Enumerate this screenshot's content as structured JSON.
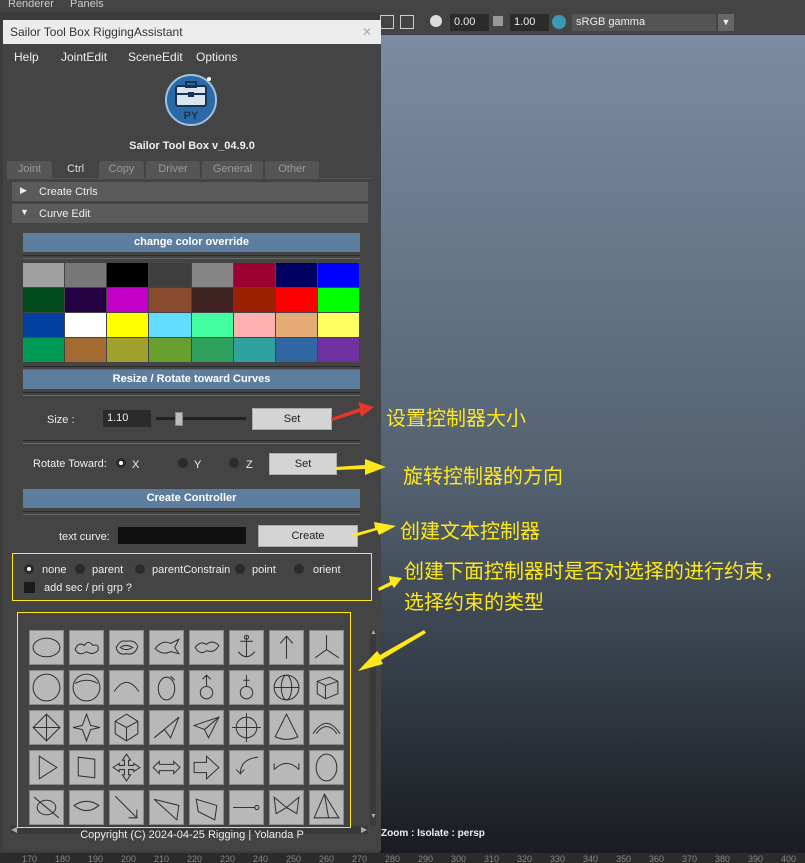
{
  "maya": {
    "menus": [
      "Renderer",
      "Panels"
    ],
    "toolbar": {
      "value1": "0.00",
      "value2": "1.00",
      "color_space": "sRGB gamma"
    },
    "viewport_status": "Zoom : Isolate : persp",
    "timeline_ticks": [
      "170",
      "180",
      "190",
      "200",
      "210",
      "220",
      "230",
      "240",
      "250",
      "260",
      "270",
      "280",
      "290",
      "300",
      "310",
      "320",
      "330",
      "340",
      "350",
      "360",
      "370",
      "380",
      "390",
      "400"
    ]
  },
  "window": {
    "title": "Sailor Tool Box RiggingAssistant",
    "menus": [
      "Help",
      "JointEdit",
      "SceneEdit",
      "Options"
    ],
    "logo_text": "PY",
    "version": "Sailor Tool Box v_04.9.0",
    "tabs": [
      "Joint",
      "Ctrl",
      "Copy",
      "Driver",
      "General",
      "Other"
    ],
    "active_tab": "Ctrl",
    "frames": {
      "create_ctrls": "Create Ctrls",
      "curve_edit": "Curve Edit"
    },
    "sections": {
      "color_override": "change color override",
      "resize_rotate": "Resize / Rotate toward Curves",
      "create_controller": "Create Controller"
    },
    "palette": [
      "#a0a0a0",
      "#787878",
      "#000000",
      "#3f3f3f",
      "#868686",
      "#9a0030",
      "#000060",
      "#0000ff",
      "#004a1c",
      "#250043",
      "#c400c8",
      "#894c30",
      "#3f2322",
      "#9a2100",
      "#ff0000",
      "#00ff00",
      "#0041a0",
      "#ffffff",
      "#ffff00",
      "#64dcff",
      "#43ffa2",
      "#ffb0b0",
      "#e4ab78",
      "#ffff63",
      "#009a54",
      "#a36a31",
      "#9fa030",
      "#68a030",
      "#30a15c",
      "#30a19c",
      "#3066a1",
      "#6f30a1"
    ],
    "size_label": "Size :",
    "size_value": "1.10",
    "set_label": "Set",
    "rotate_label": "Rotate Toward:",
    "axes": [
      "X",
      "Y",
      "Z"
    ],
    "text_curve_label": "text curve:",
    "text_curve_value": "",
    "create_label": "Create",
    "constraints": [
      "none",
      "parent",
      "parentConstrain",
      "point",
      "orient"
    ],
    "add_grp_label": "add sec / pri grp ?",
    "copyright": "Copyright (C)  2024-04-25 Rigging  | Yolanda P"
  },
  "annotations": {
    "size": "设置控制器大小",
    "rotate": "旋转控制器的方向",
    "text": "创建文本控制器",
    "constraint": "创建下面控制器时是否对选择的进行约束，选择约束的类型"
  },
  "colors": {
    "annotation": "#ffe81a",
    "arrow_red": "#e8352c",
    "section_blue": "#5e7ea0"
  }
}
